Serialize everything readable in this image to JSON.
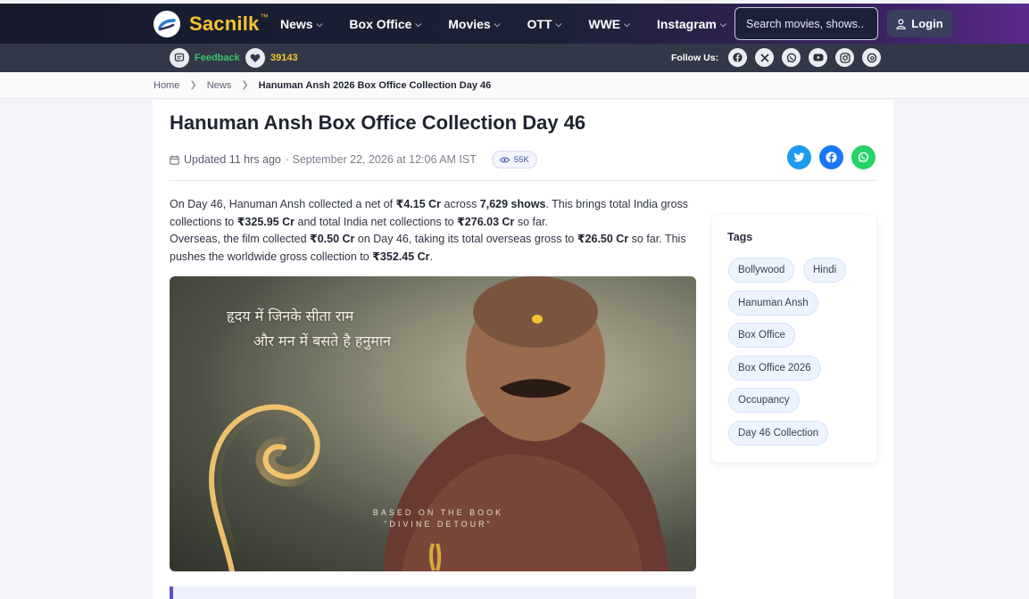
{
  "header": {
    "brand": "Sacnilk",
    "brand_tm": "™",
    "nav": [
      {
        "label": "News"
      },
      {
        "label": "Box Office"
      },
      {
        "label": "Movies"
      },
      {
        "label": "OTT"
      },
      {
        "label": "WWE"
      },
      {
        "label": "Instagram"
      }
    ],
    "search_placeholder": "Search movies, shows..",
    "login_label": "Login"
  },
  "subbar": {
    "feedback_label": "Feedback",
    "likes": "39143",
    "follow_label": "Follow Us:",
    "socials": [
      "facebook-icon",
      "x-icon",
      "whatsapp-icon",
      "youtube-icon",
      "instagram-icon",
      "threads-icon"
    ]
  },
  "breadcrumb": {
    "home": "Home",
    "news": "News",
    "current": "Hanuman Ansh 2026 Box Office Collection Day 46"
  },
  "article": {
    "title": "Hanuman Ansh Box Office Collection Day 46",
    "updated": "Updated 11 hrs ago",
    "date": "· September 22, 2026 at 12:06 AM IST",
    "views": "55K",
    "p1": {
      "t1": "On Day 46, Hanuman Ansh collected a net of ",
      "b1": "₹4.15 Cr",
      "t2": " across ",
      "b2": "7,629 shows",
      "t3": ". This brings total India gross collections to ",
      "b3": "₹325.95 Cr",
      "t4": " and total India net collections to ",
      "b4": "₹276.03 Cr",
      "t5": " so far."
    },
    "p2": {
      "t1": "Overseas, the film collected ",
      "b1": "₹0.50 Cr",
      "t2": " on Day 46, taking its total overseas gross to ",
      "b2": "₹26.50 Cr",
      "t3": " so far. This pushes the worldwide gross collection to ",
      "b3": "₹352.45 Cr",
      "t4": "."
    },
    "poster": {
      "line1": "हृदय में जिनके सीता राम",
      "line2": "और मन में बसते है हनुमान",
      "book1": "BASED ON THE BOOK",
      "book2": "\"DIVINE DETOUR\""
    }
  },
  "tags": {
    "title": "Tags",
    "items": [
      "Bollywood",
      "Hindi",
      "Hanuman Ansh",
      "Box Office",
      "Box Office 2026",
      "Occupancy",
      "Day 46 Collection"
    ]
  },
  "colors": {
    "brand_yellow": "#f7c531",
    "feedback_green": "#37c46b",
    "twitter": "#1d9bf0",
    "facebook": "#1877f2",
    "whatsapp": "#25d366"
  }
}
